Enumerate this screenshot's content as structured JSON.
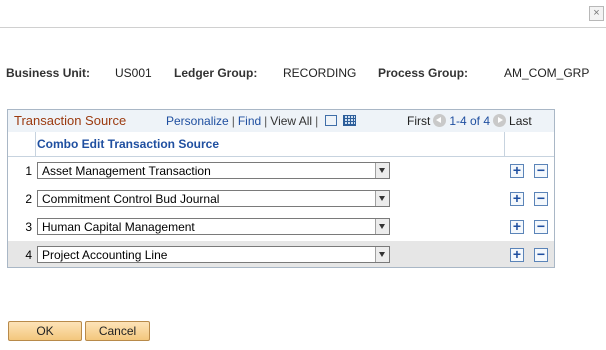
{
  "dialog": {
    "close_glyph": "×"
  },
  "fields": {
    "business_unit_label": "Business Unit:",
    "business_unit_value": "US001",
    "ledger_group_label": "Ledger Group:",
    "ledger_group_value": "RECORDING",
    "process_group_label": "Process Group:",
    "process_group_value": "AM_COM_GRP"
  },
  "grid": {
    "title": "Transaction Source",
    "personalize": "Personalize",
    "find": "Find",
    "view_all": "View All",
    "separator": "|",
    "first": "First",
    "range": "1-4 of 4",
    "last": "Last",
    "column_header": "Combo Edit Transaction Source",
    "rows": [
      {
        "num": "1",
        "value": "Asset Management Transaction"
      },
      {
        "num": "2",
        "value": "Commitment Control Bud Journal"
      },
      {
        "num": "3",
        "value": "Human Capital Management"
      },
      {
        "num": "4",
        "value": "Project Accounting Line"
      }
    ],
    "add_glyph": "+",
    "remove_glyph": "−"
  },
  "buttons": {
    "ok": "OK",
    "cancel": "Cancel"
  }
}
